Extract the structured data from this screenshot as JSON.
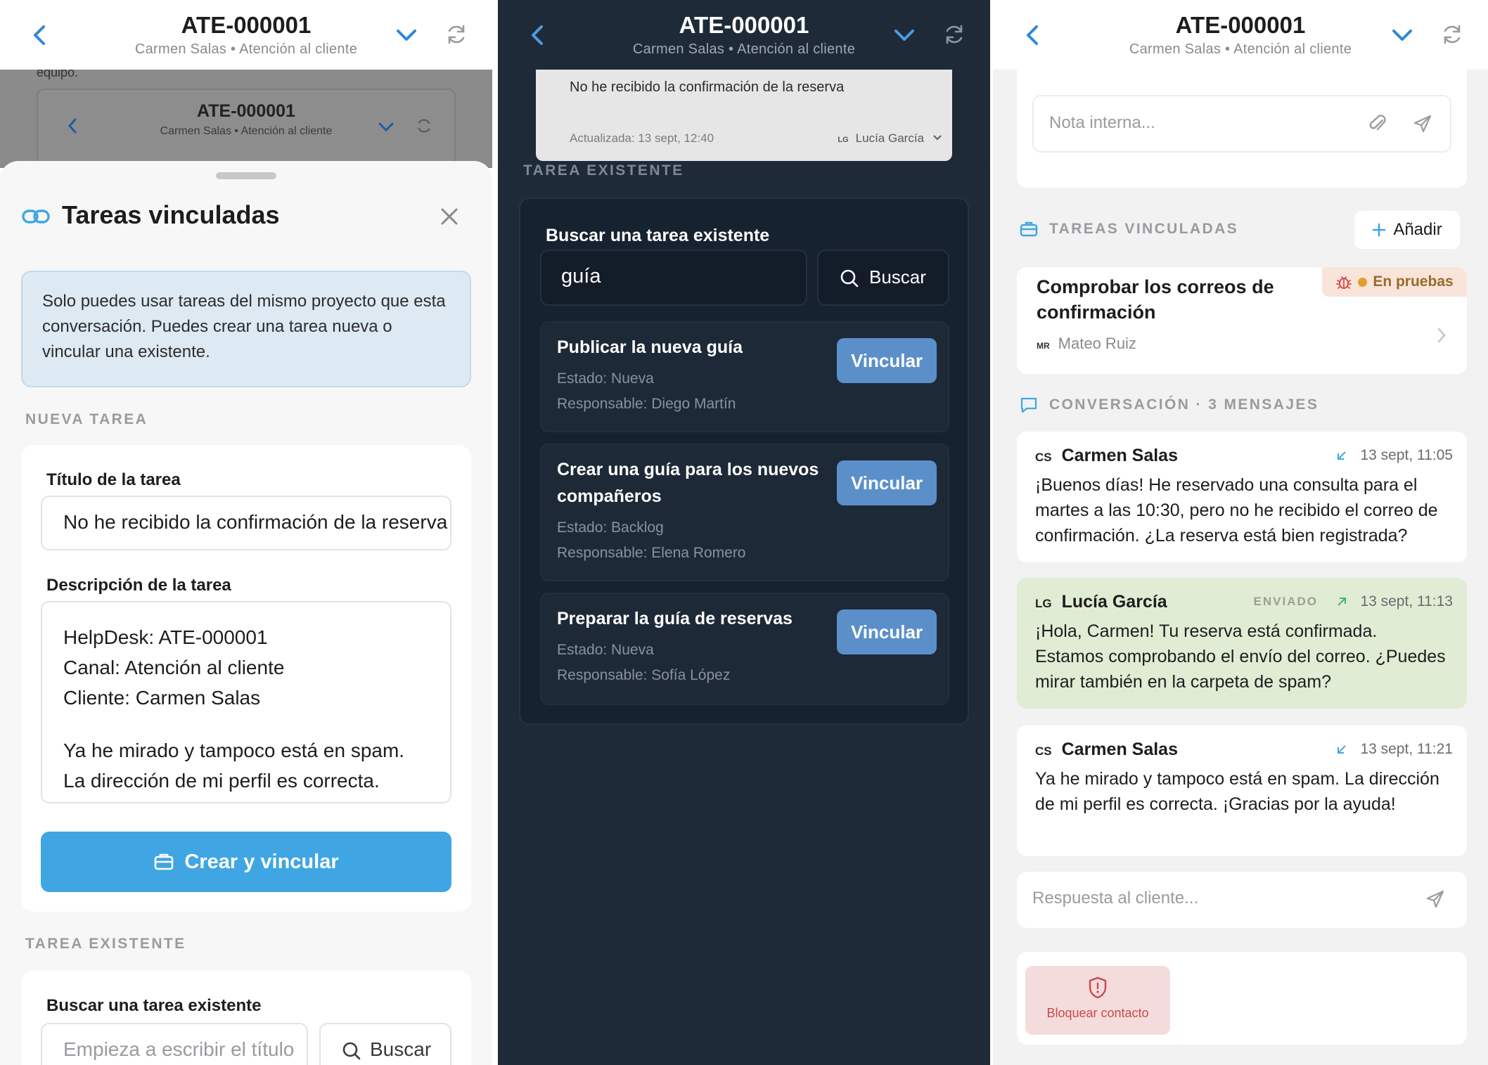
{
  "header": {
    "title": "ATE-000001",
    "subtitle": "Carmen Salas • Atención al cliente"
  },
  "panel1": {
    "bg_header": {
      "title": "ATE-000001",
      "subtitle": "Carmen Salas • Atención al cliente",
      "clipped_text": "equipo."
    },
    "sheet_title": "Tareas vinculadas",
    "info": "Solo puedes usar tareas del mismo proyecto que esta conversación. Puedes crear una tarea nueva o vincular una existente.",
    "new_section": "NUEVA TAREA",
    "title_label": "Título de la tarea",
    "title_value": "No he recibido la confirmación de la reserva",
    "desc_label": "Descripción de la tarea",
    "desc_lines": [
      "HelpDesk: ATE-000001",
      "Canal: Atención al cliente",
      "Cliente: Carmen Salas",
      "",
      "Ya he mirado y tampoco está en spam.",
      "La dirección de mi perfil es correcta."
    ],
    "create_button": "Crear y vincular",
    "existing_section": "TAREA EXISTENTE",
    "search_label": "Buscar una tarea existente",
    "search_placeholder": "Empieza a escribir el título",
    "search_button": "Buscar"
  },
  "panel2": {
    "top_card": {
      "text": "No he recibido la confirmación de la reserva",
      "updated": "Actualizada: 13 sept, 12:40",
      "assignee_initials": "LG",
      "assignee": "Lucía García"
    },
    "existing_section": "TAREA EXISTENTE",
    "search_label": "Buscar una tarea existente",
    "search_value": "guía",
    "search_button": "Buscar",
    "results": [
      {
        "title": "Publicar la nueva guía",
        "status": "Estado: Nueva",
        "owner": "Responsable: Diego Martín",
        "action": "Vincular"
      },
      {
        "title": "Crear una guía para los nuevos compañeros",
        "status": "Estado: Backlog",
        "owner": "Responsable: Elena Romero",
        "action": "Vincular"
      },
      {
        "title": "Preparar la guía de reservas",
        "status": "Estado: Nueva",
        "owner": "Responsable: Sofía López",
        "action": "Vincular"
      }
    ]
  },
  "panel3": {
    "note_placeholder": "Nota interna...",
    "linked_section": "TAREAS VINCULADAS",
    "add_button": "Añadir",
    "task": {
      "title": "Comprobar los correos de confirmación",
      "status": "En pruebas",
      "assignee_initials": "MR",
      "assignee": "Mateo Ruiz"
    },
    "conv_section": "CONVERSACIÓN · 3 MENSAJES",
    "messages": [
      {
        "initials": "CS",
        "author": "Carmen Salas",
        "time": "13 sept, 11:05",
        "tag": "",
        "text": "¡Buenos días! He reservado una consulta para el martes a las 10:30, pero no he recibido el correo de confirmación. ¿La reserva está bien registrada?"
      },
      {
        "initials": "LG",
        "author": "Lucía García",
        "time": "13 sept, 11:13",
        "tag": "ENVIADO",
        "text": "¡Hola, Carmen! Tu reserva está confirmada. Estamos comprobando el envío del correo. ¿Puedes mirar también en la carpeta de spam?"
      },
      {
        "initials": "CS",
        "author": "Carmen Salas",
        "time": "13 sept, 11:21",
        "tag": "",
        "text": "Ya he mirado y tampoco está en spam. La dirección de mi perfil es correcta. ¡Gracias por la ayuda!"
      }
    ],
    "reply_placeholder": "Respuesta al cliente...",
    "block_button": "Bloquear contacto"
  },
  "colors": {
    "accent": "#3fa6e3",
    "link_blue": "#2f88d8",
    "vincular": "#5b8fca",
    "dark_bg": "#1e2a38",
    "sent_bubble": "#e1ecd4",
    "status_dot": "#e0a030",
    "block_bg": "#f5dcdc",
    "block_fg": "#c84a4a"
  },
  "icons": {
    "back": "chevron-left-icon",
    "expand": "chevron-down-icon",
    "refresh": "refresh-icon",
    "link": "link-icon",
    "close": "close-icon",
    "search": "search-icon",
    "briefcase": "briefcase-icon",
    "attach": "paperclip-icon",
    "send": "send-icon",
    "plus": "plus-icon",
    "bug": "bug-icon",
    "chat": "chat-icon",
    "incoming": "arrow-incoming-icon",
    "outgoing": "arrow-outgoing-icon",
    "shield": "shield-alert-icon"
  }
}
